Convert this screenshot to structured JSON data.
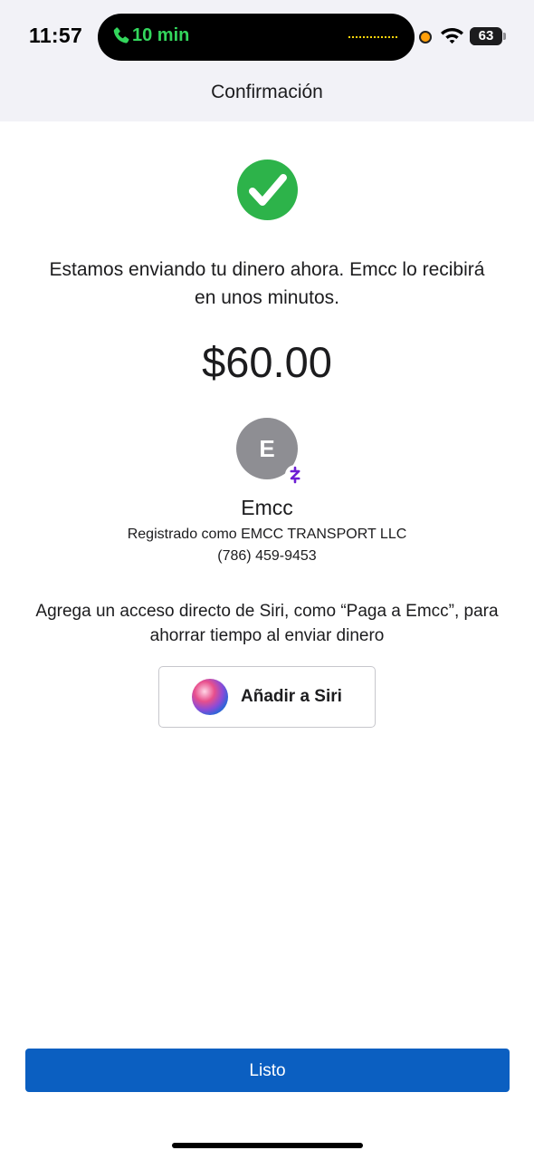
{
  "status_bar": {
    "time": "11:57",
    "call_duration": "10 min",
    "battery_level": "63"
  },
  "nav": {
    "title": "Confirmación"
  },
  "confirmation": {
    "message": "Estamos enviando tu dinero ahora. Emcc lo recibirá en unos minutos.",
    "amount": "$60.00"
  },
  "recipient": {
    "initial": "E",
    "name": "Emcc",
    "registered_as": "Registrado como EMCC TRANSPORT LLC",
    "phone": "(786) 459-9453"
  },
  "siri": {
    "prompt": "Agrega un acceso directo de Siri, como “Paga a Emcc”, para ahorrar tiempo al enviar dinero",
    "button_label": "Añadir a Siri"
  },
  "footer": {
    "done_label": "Listo"
  },
  "colors": {
    "primary": "#0b5fc1",
    "success": "#2db34a",
    "call_green": "#33d65c",
    "zelle_purple": "#6d1ed4"
  },
  "icons": [
    "phone-call-icon",
    "wifi-icon",
    "battery-icon",
    "checkmark-icon",
    "zelle-icon",
    "siri-icon"
  ]
}
